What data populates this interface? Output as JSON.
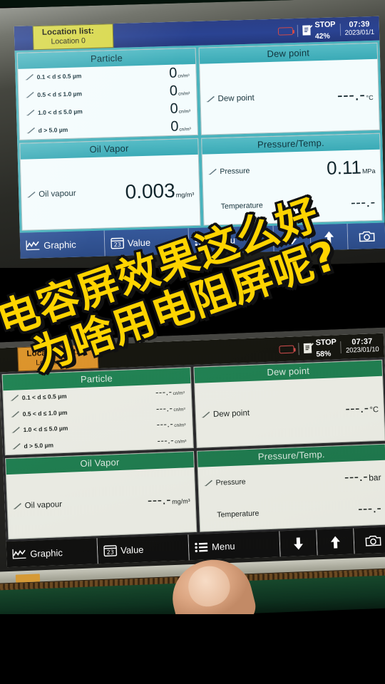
{
  "caption": {
    "line1": "电容屏效果这么好",
    "line2": "为啥用电阻屏呢?"
  },
  "devices": {
    "top": {
      "name": "capacitive-screen-device",
      "status": {
        "location_title": "Location list:",
        "location_value": "Location 0",
        "battery_icon": "battery-icon",
        "record_icon": "record-document-icon",
        "record_state": "STOP",
        "record_percent": "42%",
        "time": "07:39",
        "date": "2023/01/1"
      },
      "panels": {
        "particle": {
          "title": "Particle",
          "rows": [
            {
              "label": "0.1 < d ≤ 0.5 µm",
              "value": "0",
              "unit": "cn/m³",
              "icon": "pencil-icon"
            },
            {
              "label": "0.5 < d ≤ 1.0 µm",
              "value": "0",
              "unit": "cn/m³",
              "icon": "pencil-icon"
            },
            {
              "label": "1.0 < d ≤ 5.0 µm",
              "value": "0",
              "unit": "cn/m³",
              "icon": "pencil-icon"
            },
            {
              "label": "d > 5.0 µm",
              "value": "0",
              "unit": "cn/m³",
              "icon": "pencil-icon"
            }
          ]
        },
        "dew_point": {
          "title": "Dew point",
          "rows": [
            {
              "label": "Dew point",
              "value": "---.-",
              "unit": "°C",
              "icon": "pencil-icon"
            }
          ]
        },
        "oil_vapor": {
          "title": "Oil Vapor",
          "rows": [
            {
              "label": "Oil vapour",
              "value": "0.003",
              "unit": "mg/m³",
              "icon": "pencil-icon"
            }
          ]
        },
        "pressure_temp": {
          "title": "Pressure/Temp.",
          "rows": [
            {
              "label": "Pressure",
              "value": "0.11",
              "unit": "MPa",
              "icon": "pencil-icon"
            },
            {
              "label": "Temperature",
              "value": "---.-",
              "unit": "",
              "icon": "none"
            }
          ]
        }
      },
      "toolbar": [
        {
          "label": "Graphic",
          "icon": "graph-line-icon"
        },
        {
          "label": "Value",
          "icon": "value-23-icon"
        },
        {
          "label": "Menu",
          "icon": "list-menu-icon"
        },
        {
          "label": "",
          "icon": "arrow-down-icon"
        },
        {
          "label": "",
          "icon": "arrow-up-icon"
        },
        {
          "label": "",
          "icon": "camera-icon"
        }
      ]
    },
    "bottom": {
      "name": "resistive-screen-device",
      "status": {
        "location_title": "Location list:",
        "location_value": "Location 0",
        "battery_icon": "battery-icon",
        "record_icon": "record-document-icon",
        "record_state": "STOP",
        "record_percent": "58%",
        "time": "07:37",
        "date": "2023/01/10"
      },
      "panels": {
        "particle": {
          "title": "Particle",
          "rows": [
            {
              "label": "0.1 < d ≤ 0.5 µm",
              "value": "---.-",
              "unit": "cn/m³",
              "icon": "pencil-icon"
            },
            {
              "label": "0.5 < d ≤ 1.0 µm",
              "value": "---.-",
              "unit": "cn/m³",
              "icon": "pencil-icon"
            },
            {
              "label": "1.0 < d ≤ 5.0 µm",
              "value": "---.-",
              "unit": "cn/m³",
              "icon": "pencil-icon"
            },
            {
              "label": "d > 5.0 µm",
              "value": "---.-",
              "unit": "cn/m³",
              "icon": "pencil-icon"
            }
          ]
        },
        "dew_point": {
          "title": "Dew point",
          "rows": [
            {
              "label": "Dew point",
              "value": "---.-",
              "unit": "°C",
              "icon": "pencil-icon"
            }
          ]
        },
        "oil_vapor": {
          "title": "Oil Vapor",
          "rows": [
            {
              "label": "Oil vapour",
              "value": "---.-",
              "unit": "mg/m³",
              "icon": "pencil-icon"
            }
          ]
        },
        "pressure_temp": {
          "title": "Pressure/Temp.",
          "rows": [
            {
              "label": "Pressure",
              "value": "---.-",
              "unit": "bar",
              "icon": "pencil-icon"
            },
            {
              "label": "Temperature",
              "value": "---.-",
              "unit": "",
              "icon": "none"
            }
          ]
        }
      },
      "toolbar": [
        {
          "label": "Graphic",
          "icon": "graph-line-icon"
        },
        {
          "label": "Value",
          "icon": "value-23-icon"
        },
        {
          "label": "Menu",
          "icon": "list-menu-icon"
        },
        {
          "label": "",
          "icon": "arrow-down-icon"
        },
        {
          "label": "",
          "icon": "arrow-up-icon"
        },
        {
          "label": "",
          "icon": "camera-icon"
        }
      ]
    }
  },
  "colors": {
    "top_statusbar": "#2a4392",
    "top_location_box": "#d8d84a",
    "top_panel_header": "#3aaab6",
    "top_toolbar": "#2d508f",
    "bottom_statusbar": "#15150f",
    "bottom_location_box": "#d98a28",
    "bottom_panel_header": "#1f7a4e",
    "bottom_toolbar": "#0d0d0b",
    "caption_yellow": "#ffd400"
  }
}
